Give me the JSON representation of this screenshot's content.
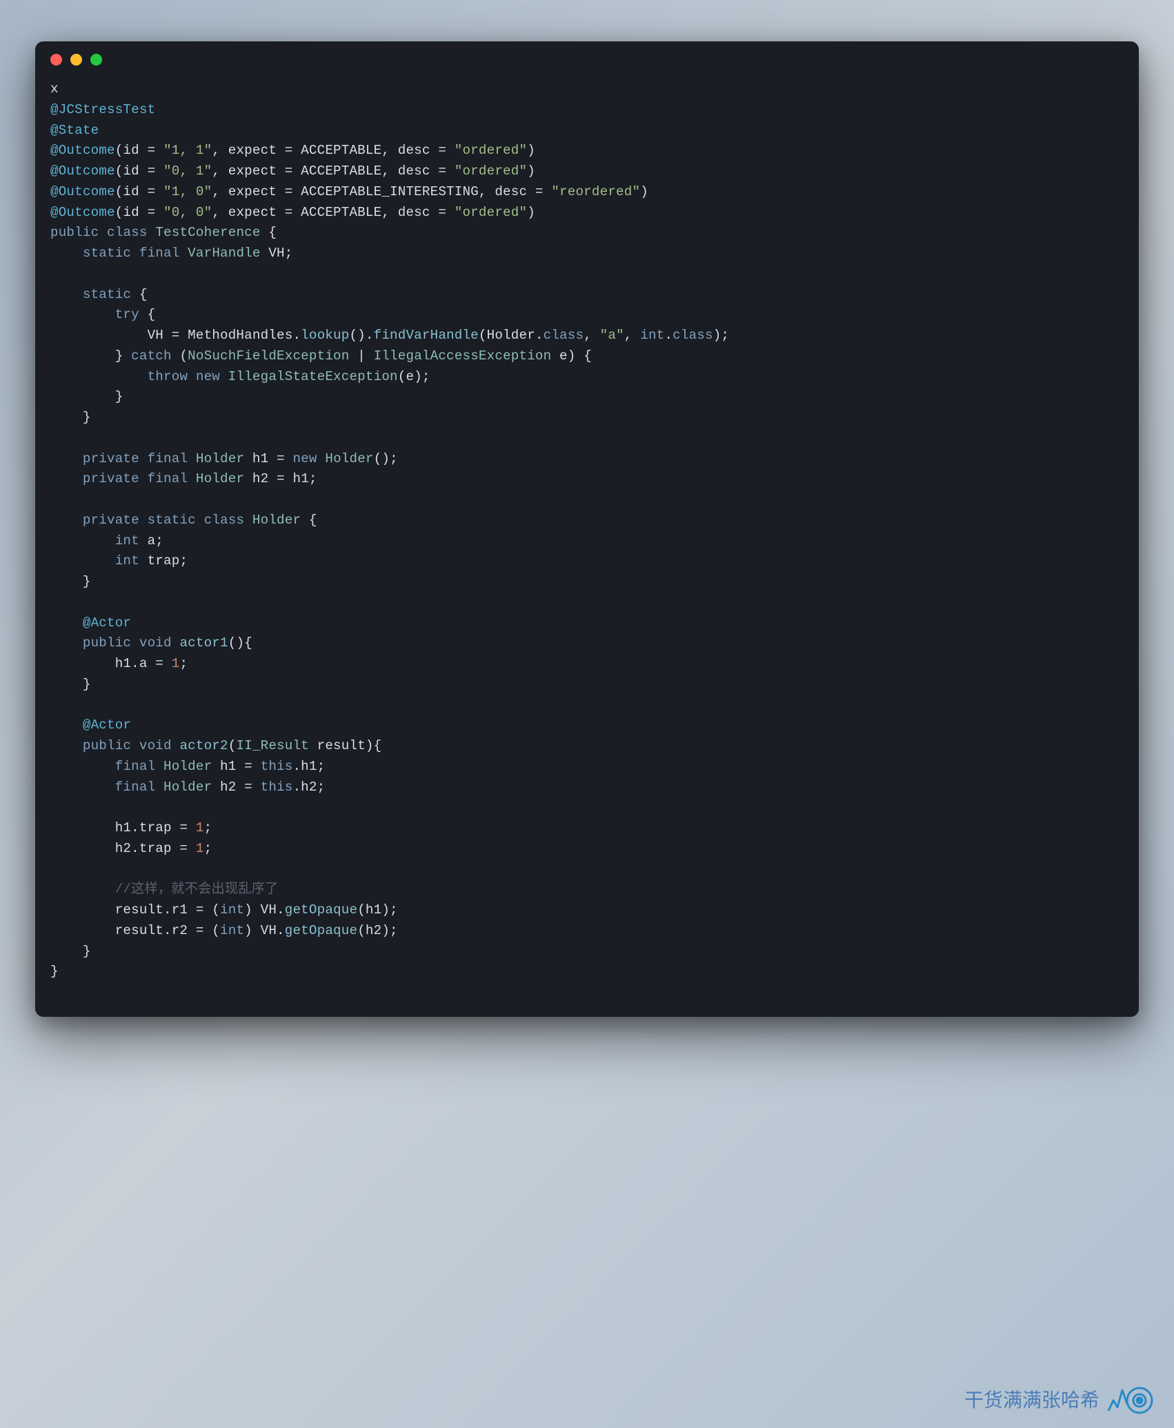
{
  "window": {
    "traffic_lights": [
      "close",
      "minimize",
      "zoom"
    ]
  },
  "code": {
    "lines": [
      [
        {
          "t": "x",
          "c": "c-plain"
        }
      ],
      [
        {
          "t": "@JCStressTest",
          "c": "c-anno"
        }
      ],
      [
        {
          "t": "@State",
          "c": "c-anno"
        }
      ],
      [
        {
          "t": "@Outcome",
          "c": "c-anno"
        },
        {
          "t": "(id = ",
          "c": "c-plain"
        },
        {
          "t": "\"1, 1\"",
          "c": "c-string"
        },
        {
          "t": ", expect = ACCEPTABLE, desc = ",
          "c": "c-plain"
        },
        {
          "t": "\"ordered\"",
          "c": "c-string"
        },
        {
          "t": ")",
          "c": "c-plain"
        }
      ],
      [
        {
          "t": "@Outcome",
          "c": "c-anno"
        },
        {
          "t": "(id = ",
          "c": "c-plain"
        },
        {
          "t": "\"0, 1\"",
          "c": "c-string"
        },
        {
          "t": ", expect = ACCEPTABLE, desc = ",
          "c": "c-plain"
        },
        {
          "t": "\"ordered\"",
          "c": "c-string"
        },
        {
          "t": ")",
          "c": "c-plain"
        }
      ],
      [
        {
          "t": "@Outcome",
          "c": "c-anno"
        },
        {
          "t": "(id = ",
          "c": "c-plain"
        },
        {
          "t": "\"1, 0\"",
          "c": "c-string"
        },
        {
          "t": ", expect = ACCEPTABLE_INTERESTING, desc = ",
          "c": "c-plain"
        },
        {
          "t": "\"reordered\"",
          "c": "c-string"
        },
        {
          "t": ")",
          "c": "c-plain"
        }
      ],
      [
        {
          "t": "@Outcome",
          "c": "c-anno"
        },
        {
          "t": "(id = ",
          "c": "c-plain"
        },
        {
          "t": "\"0, 0\"",
          "c": "c-string"
        },
        {
          "t": ", expect = ACCEPTABLE, desc = ",
          "c": "c-plain"
        },
        {
          "t": "\"ordered\"",
          "c": "c-string"
        },
        {
          "t": ")",
          "c": "c-plain"
        }
      ],
      [
        {
          "t": "public",
          "c": "c-keyword"
        },
        {
          "t": " ",
          "c": "c-plain"
        },
        {
          "t": "class",
          "c": "c-keyword"
        },
        {
          "t": " ",
          "c": "c-plain"
        },
        {
          "t": "TestCoherence",
          "c": "c-type"
        },
        {
          "t": " {",
          "c": "c-plain"
        }
      ],
      [
        {
          "t": "    ",
          "c": "c-plain"
        },
        {
          "t": "static",
          "c": "c-keyword"
        },
        {
          "t": " ",
          "c": "c-plain"
        },
        {
          "t": "final",
          "c": "c-keyword"
        },
        {
          "t": " ",
          "c": "c-plain"
        },
        {
          "t": "VarHandle",
          "c": "c-type"
        },
        {
          "t": " VH;",
          "c": "c-plain"
        }
      ],
      [
        {
          "t": "",
          "c": "c-plain"
        }
      ],
      [
        {
          "t": "    ",
          "c": "c-plain"
        },
        {
          "t": "static",
          "c": "c-keyword"
        },
        {
          "t": " {",
          "c": "c-plain"
        }
      ],
      [
        {
          "t": "        ",
          "c": "c-plain"
        },
        {
          "t": "try",
          "c": "c-keyword"
        },
        {
          "t": " {",
          "c": "c-plain"
        }
      ],
      [
        {
          "t": "            VH = MethodHandles.",
          "c": "c-plain"
        },
        {
          "t": "lookup",
          "c": "c-method"
        },
        {
          "t": "().",
          "c": "c-plain"
        },
        {
          "t": "findVarHandle",
          "c": "c-method"
        },
        {
          "t": "(Holder.",
          "c": "c-plain"
        },
        {
          "t": "class",
          "c": "c-keyword"
        },
        {
          "t": ", ",
          "c": "c-plain"
        },
        {
          "t": "\"a\"",
          "c": "c-string"
        },
        {
          "t": ", ",
          "c": "c-plain"
        },
        {
          "t": "int",
          "c": "c-keyword"
        },
        {
          "t": ".",
          "c": "c-plain"
        },
        {
          "t": "class",
          "c": "c-keyword"
        },
        {
          "t": ");",
          "c": "c-plain"
        }
      ],
      [
        {
          "t": "        } ",
          "c": "c-plain"
        },
        {
          "t": "catch",
          "c": "c-keyword"
        },
        {
          "t": " (",
          "c": "c-plain"
        },
        {
          "t": "NoSuchFieldException",
          "c": "c-type"
        },
        {
          "t": " | ",
          "c": "c-plain"
        },
        {
          "t": "IllegalAccessException",
          "c": "c-type"
        },
        {
          "t": " e) {",
          "c": "c-plain"
        }
      ],
      [
        {
          "t": "            ",
          "c": "c-plain"
        },
        {
          "t": "throw",
          "c": "c-keyword"
        },
        {
          "t": " ",
          "c": "c-plain"
        },
        {
          "t": "new",
          "c": "c-keyword"
        },
        {
          "t": " ",
          "c": "c-plain"
        },
        {
          "t": "IllegalStateException",
          "c": "c-type"
        },
        {
          "t": "(e);",
          "c": "c-plain"
        }
      ],
      [
        {
          "t": "        }",
          "c": "c-plain"
        }
      ],
      [
        {
          "t": "    }",
          "c": "c-plain"
        }
      ],
      [
        {
          "t": "",
          "c": "c-plain"
        }
      ],
      [
        {
          "t": "    ",
          "c": "c-plain"
        },
        {
          "t": "private",
          "c": "c-keyword"
        },
        {
          "t": " ",
          "c": "c-plain"
        },
        {
          "t": "final",
          "c": "c-keyword"
        },
        {
          "t": " ",
          "c": "c-plain"
        },
        {
          "t": "Holder",
          "c": "c-type"
        },
        {
          "t": " h1 = ",
          "c": "c-plain"
        },
        {
          "t": "new",
          "c": "c-keyword"
        },
        {
          "t": " ",
          "c": "c-plain"
        },
        {
          "t": "Holder",
          "c": "c-type"
        },
        {
          "t": "();",
          "c": "c-plain"
        }
      ],
      [
        {
          "t": "    ",
          "c": "c-plain"
        },
        {
          "t": "private",
          "c": "c-keyword"
        },
        {
          "t": " ",
          "c": "c-plain"
        },
        {
          "t": "final",
          "c": "c-keyword"
        },
        {
          "t": " ",
          "c": "c-plain"
        },
        {
          "t": "Holder",
          "c": "c-type"
        },
        {
          "t": " h2 = h1;",
          "c": "c-plain"
        }
      ],
      [
        {
          "t": "",
          "c": "c-plain"
        }
      ],
      [
        {
          "t": "    ",
          "c": "c-plain"
        },
        {
          "t": "private",
          "c": "c-keyword"
        },
        {
          "t": " ",
          "c": "c-plain"
        },
        {
          "t": "static",
          "c": "c-keyword"
        },
        {
          "t": " ",
          "c": "c-plain"
        },
        {
          "t": "class",
          "c": "c-keyword"
        },
        {
          "t": " ",
          "c": "c-plain"
        },
        {
          "t": "Holder",
          "c": "c-type"
        },
        {
          "t": " {",
          "c": "c-plain"
        }
      ],
      [
        {
          "t": "        ",
          "c": "c-plain"
        },
        {
          "t": "int",
          "c": "c-keyword"
        },
        {
          "t": " a;",
          "c": "c-plain"
        }
      ],
      [
        {
          "t": "        ",
          "c": "c-plain"
        },
        {
          "t": "int",
          "c": "c-keyword"
        },
        {
          "t": " trap;",
          "c": "c-plain"
        }
      ],
      [
        {
          "t": "    }",
          "c": "c-plain"
        }
      ],
      [
        {
          "t": "",
          "c": "c-plain"
        }
      ],
      [
        {
          "t": "    ",
          "c": "c-plain"
        },
        {
          "t": "@Actor",
          "c": "c-anno"
        }
      ],
      [
        {
          "t": "    ",
          "c": "c-plain"
        },
        {
          "t": "public",
          "c": "c-keyword"
        },
        {
          "t": " ",
          "c": "c-plain"
        },
        {
          "t": "void",
          "c": "c-keyword"
        },
        {
          "t": " ",
          "c": "c-plain"
        },
        {
          "t": "actor1",
          "c": "c-method"
        },
        {
          "t": "(){",
          "c": "c-plain"
        }
      ],
      [
        {
          "t": "        h1.a = ",
          "c": "c-plain"
        },
        {
          "t": "1",
          "c": "c-number"
        },
        {
          "t": ";",
          "c": "c-plain"
        }
      ],
      [
        {
          "t": "    }",
          "c": "c-plain"
        }
      ],
      [
        {
          "t": "",
          "c": "c-plain"
        }
      ],
      [
        {
          "t": "    ",
          "c": "c-plain"
        },
        {
          "t": "@Actor",
          "c": "c-anno"
        }
      ],
      [
        {
          "t": "    ",
          "c": "c-plain"
        },
        {
          "t": "public",
          "c": "c-keyword"
        },
        {
          "t": " ",
          "c": "c-plain"
        },
        {
          "t": "void",
          "c": "c-keyword"
        },
        {
          "t": " ",
          "c": "c-plain"
        },
        {
          "t": "actor2",
          "c": "c-method"
        },
        {
          "t": "(",
          "c": "c-plain"
        },
        {
          "t": "II_Result",
          "c": "c-type"
        },
        {
          "t": " result){",
          "c": "c-plain"
        }
      ],
      [
        {
          "t": "        ",
          "c": "c-plain"
        },
        {
          "t": "final",
          "c": "c-keyword"
        },
        {
          "t": " ",
          "c": "c-plain"
        },
        {
          "t": "Holder",
          "c": "c-type"
        },
        {
          "t": " h1 = ",
          "c": "c-plain"
        },
        {
          "t": "this",
          "c": "c-keyword"
        },
        {
          "t": ".h1;",
          "c": "c-plain"
        }
      ],
      [
        {
          "t": "        ",
          "c": "c-plain"
        },
        {
          "t": "final",
          "c": "c-keyword"
        },
        {
          "t": " ",
          "c": "c-plain"
        },
        {
          "t": "Holder",
          "c": "c-type"
        },
        {
          "t": " h2 = ",
          "c": "c-plain"
        },
        {
          "t": "this",
          "c": "c-keyword"
        },
        {
          "t": ".h2;",
          "c": "c-plain"
        }
      ],
      [
        {
          "t": "",
          "c": "c-plain"
        }
      ],
      [
        {
          "t": "        h1.trap = ",
          "c": "c-plain"
        },
        {
          "t": "1",
          "c": "c-number"
        },
        {
          "t": ";",
          "c": "c-plain"
        }
      ],
      [
        {
          "t": "        h2.trap = ",
          "c": "c-plain"
        },
        {
          "t": "1",
          "c": "c-number"
        },
        {
          "t": ";",
          "c": "c-plain"
        }
      ],
      [
        {
          "t": "",
          "c": "c-plain"
        }
      ],
      [
        {
          "t": "        ",
          "c": "c-plain"
        },
        {
          "t": "//这样，就不会出现乱序了",
          "c": "c-comment"
        }
      ],
      [
        {
          "t": "        result.r1 = (",
          "c": "c-plain"
        },
        {
          "t": "int",
          "c": "c-keyword"
        },
        {
          "t": ") VH.",
          "c": "c-plain"
        },
        {
          "t": "getOpaque",
          "c": "c-method"
        },
        {
          "t": "(h1);",
          "c": "c-plain"
        }
      ],
      [
        {
          "t": "        result.r2 = (",
          "c": "c-plain"
        },
        {
          "t": "int",
          "c": "c-keyword"
        },
        {
          "t": ") VH.",
          "c": "c-plain"
        },
        {
          "t": "getOpaque",
          "c": "c-method"
        },
        {
          "t": "(h2);",
          "c": "c-plain"
        }
      ],
      [
        {
          "t": "    }",
          "c": "c-plain"
        }
      ],
      [
        {
          "t": "}",
          "c": "c-plain"
        }
      ]
    ]
  },
  "watermark": {
    "text": "干货满满张哈希"
  }
}
